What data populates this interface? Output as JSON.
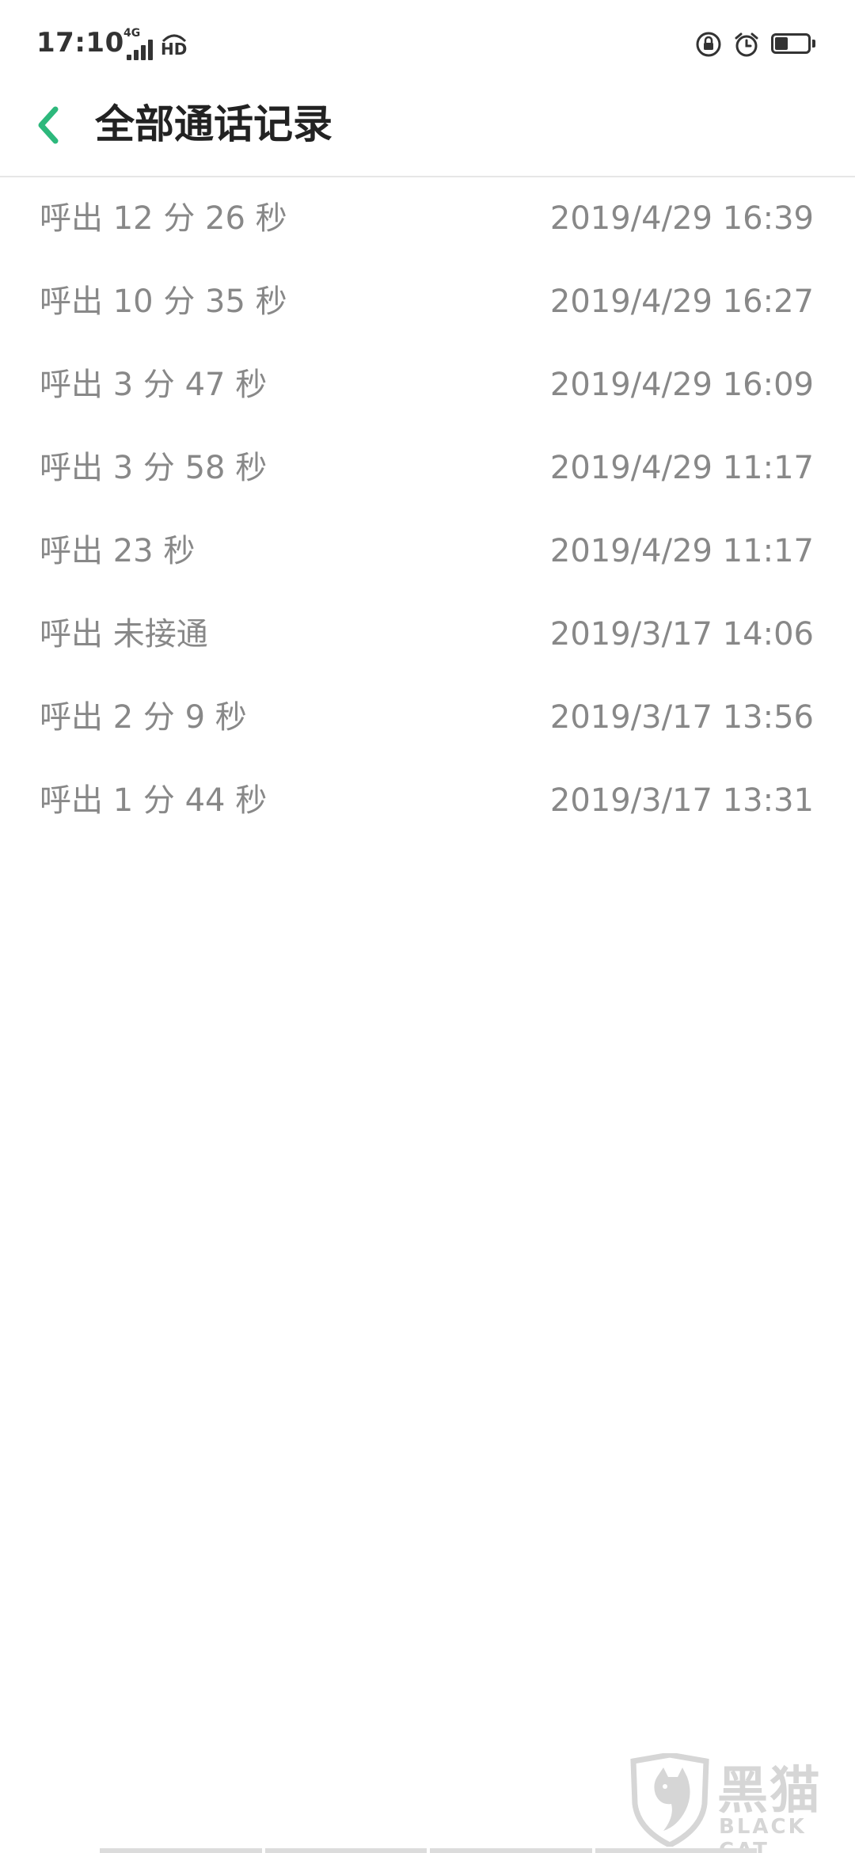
{
  "status_bar": {
    "time": "17:10",
    "network_type": "4G",
    "hd_label": "HD",
    "battery_level": 0.4,
    "icons": [
      "rotation-lock-icon",
      "alarm-icon",
      "battery-icon"
    ]
  },
  "header": {
    "back_icon": "chevron-left-icon",
    "title": "全部通话记录"
  },
  "calls": [
    {
      "desc": "呼出  12 分 26 秒",
      "time": "2019/4/29 16:39"
    },
    {
      "desc": "呼出  10 分 35 秒",
      "time": "2019/4/29 16:27"
    },
    {
      "desc": "呼出  3 分 47 秒",
      "time": "2019/4/29 16:09"
    },
    {
      "desc": "呼出  3 分 58 秒",
      "time": "2019/4/29 11:17"
    },
    {
      "desc": "呼出  23 秒",
      "time": "2019/4/29 11:17"
    },
    {
      "desc": "呼出 未接通",
      "time": "2019/3/17 14:06"
    },
    {
      "desc": "呼出  2 分 9 秒",
      "time": "2019/3/17 13:56"
    },
    {
      "desc": "呼出  1 分 44 秒",
      "time": "2019/3/17 13:31"
    }
  ],
  "watermark": {
    "cn": "黑猫",
    "en": "BLACK CAT"
  },
  "colors": {
    "accent": "#2db87c",
    "text_secondary": "#888888",
    "title": "#222222"
  }
}
